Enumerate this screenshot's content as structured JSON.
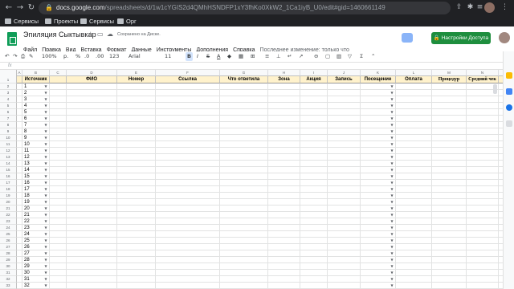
{
  "browser": {
    "url_host": "docs.google.com",
    "url_path": "/spreadsheets/d/1w1cYGIS2d4QMhHSNDFP1xY3fhKo0XkW2_1Ca1iyB_U0/edit#gid=1460661149",
    "bookmarks": [
      {
        "label": "Сервисы",
        "icon": "apps-grid-icon"
      },
      {
        "label": "Проекты",
        "icon": "folder-icon"
      },
      {
        "label": "Сервисы",
        "icon": "folder-icon"
      },
      {
        "label": "Орг",
        "icon": "folder-icon"
      }
    ]
  },
  "doc": {
    "title": "Эпиляция Сыктывкар",
    "saved_status": "Сохранено на Диске.",
    "menus": [
      "Файл",
      "Правка",
      "Вид",
      "Вставка",
      "Формат",
      "Данные",
      "Инструменты",
      "Дополнения",
      "Справка"
    ],
    "last_edit": "Последнее изменение: только что",
    "share_label": "Настройки Доступа"
  },
  "toolbar": {
    "zoom": "100%",
    "currency": "р.",
    "percent": "%",
    "dec_less": ".0",
    "dec_more": ".00",
    "format": "123",
    "font": "Arial",
    "size": "11",
    "bold": "B",
    "italic": "I",
    "strike": "S",
    "text_color": "A",
    "sum": "Σ"
  },
  "formula": {
    "fx": "fx"
  },
  "columns": [
    "A",
    "B",
    "C",
    "D",
    "E",
    "F",
    "G",
    "H",
    "I",
    "J",
    "K",
    "L",
    "M",
    "N",
    "O"
  ],
  "headers": [
    "",
    "Источник",
    "",
    "ФИО",
    "Номер",
    "Ссылка",
    "Что ответила",
    "Зона",
    "Акция",
    "Запись",
    "Посещение",
    "Оплата",
    "Процедур",
    "Средний чек",
    "Метк"
  ],
  "row_numbers": [
    "2",
    "3",
    "4",
    "5",
    "6",
    "7",
    "8",
    "9",
    "10",
    "11",
    "12",
    "13",
    "14",
    "15",
    "16",
    "17",
    "18",
    "19",
    "20",
    "21",
    "22",
    "23",
    "24",
    "25",
    "26",
    "27",
    "28",
    "29",
    "30",
    "31",
    "32",
    "33"
  ],
  "cell_values": [
    "1",
    "2",
    "3",
    "4",
    "5",
    "6",
    "7",
    "8",
    "9",
    "10",
    "11",
    "12",
    "13",
    "14",
    "15",
    "16",
    "17",
    "18",
    "19",
    "20",
    "21",
    "22",
    "23",
    "24",
    "25",
    "26",
    "27",
    "28",
    "29",
    "30",
    "31",
    "32"
  ],
  "colors": {
    "header_fill": "#fff2cc",
    "share_button": "#1e8e3e",
    "sheets_green": "#0f9d58",
    "chrome_bg": "#202124"
  }
}
